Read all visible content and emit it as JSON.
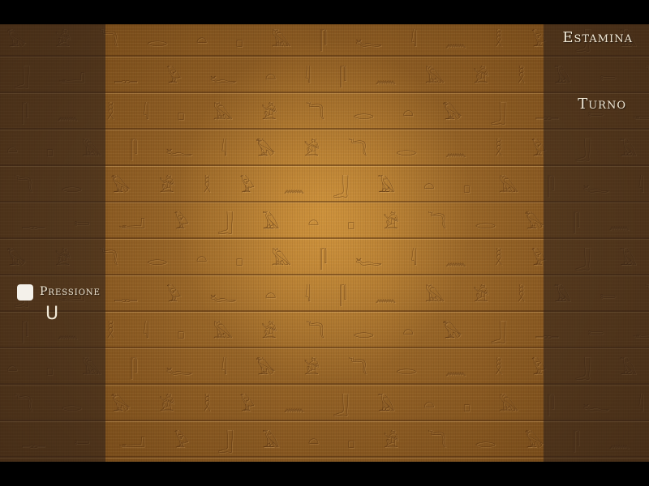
{
  "hud": {
    "stamina_label": "Estamina",
    "turn_label": "Turno",
    "pressure_label": "Pressione",
    "pressure_key": "U"
  },
  "background": {
    "glyphs": [
      "𓅃 𓀀 𓆓 𓂋 𓏏 𓊪 𓅓 𓋴 𓆑 𓇋 𓈖 𓎛 𓅱 𓃀 𓄿 𓊃 𓍿 𓂝 𓆣 𓁐 𓅃 𓀀 𓆓",
      "𓃀 𓂝 𓊃 𓅱 𓆑 𓏏 𓇋 𓋴 𓈖 𓅓 𓀀 𓎛 𓄿 𓍿 𓆓 𓂋 𓊪 𓅃 𓁐 𓆣 𓃀 𓂝 𓊃",
      "𓋴 𓈖 𓎛 𓇋 𓊪 𓅓 𓀀 𓆓 𓂋 𓏏 𓅃 𓃀 𓊃 𓍿 𓂝 𓆑 𓅱 𓄿 𓁐 𓆣 𓋴 𓈖 𓎛",
      "𓏏 𓊪 𓅓 𓋴 𓆑 𓇋 𓅃 𓀀 𓆓 𓂋 𓈖 𓎛 𓅱 𓃀 𓄿 𓊃 𓍿 𓂝 𓆣 𓁐 𓏏 𓊪 𓅓",
      "𓆓 𓂋 𓅃 𓀀 𓎛 𓅱 𓈖 𓃀 𓄿 𓏏 𓊪 𓅓 𓋴 𓆑 𓇋 𓊃 𓍿 𓂝 𓆣 𓁐 𓆓 𓂋 𓅃",
      "𓊃 𓍿 𓂝 𓅱 𓃀 𓄿 𓏏 𓊪 𓀀 𓆓 𓂋 𓅃 𓋴 𓈖 𓎛 𓇋 𓆑 𓅓 𓁐 𓆣 𓊃 𓍿 𓂝"
    ]
  }
}
